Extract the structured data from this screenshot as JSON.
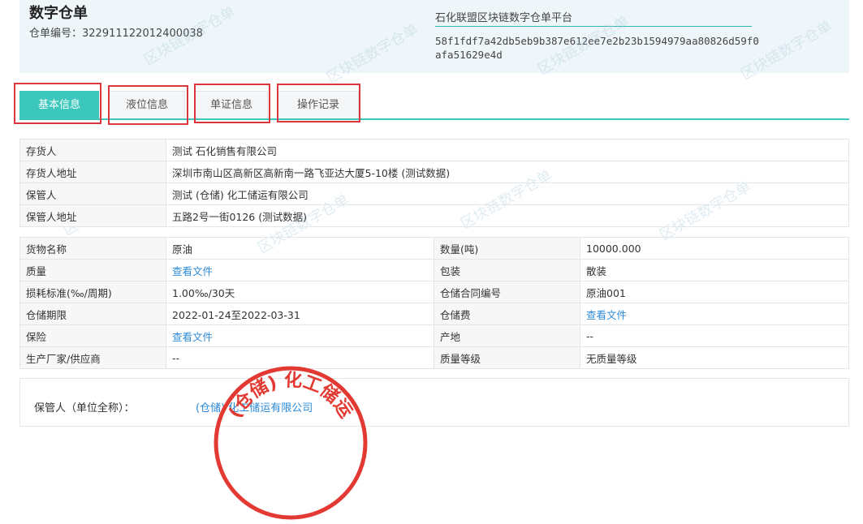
{
  "header": {
    "title": "数字仓单",
    "receipt_no": "仓单编号：322911122012400038",
    "platform": "石化联盟区块链数字仓单平台",
    "hash": "58f1fdf7a42db5eb9b387e612ee7e2b23b1594979aa80826d59f0afa51629e4d"
  },
  "watermark_text": "区块链数字仓单",
  "tabs": [
    {
      "label": "基本信息",
      "active": true
    },
    {
      "label": "液位信息",
      "active": false
    },
    {
      "label": "单证信息",
      "active": false
    },
    {
      "label": "操作记录",
      "active": false
    }
  ],
  "party": {
    "depositor_label": "存货人",
    "depositor_value": "测试 石化销售有限公司",
    "depositor_addr_label": "存货人地址",
    "depositor_addr_value": "深圳市南山区高新区高新南一路飞亚达大厦5-10楼 (测试数据)",
    "keeper_label": "保管人",
    "keeper_value": "测试 (仓储) 化工储运有限公司",
    "keeper_addr_label": "保管人地址",
    "keeper_addr_value": "五路2号一街0126 (测试数据)"
  },
  "goods": {
    "name_label": "货物名称",
    "name_value": "原油",
    "qty_label": "数量(吨)",
    "qty_value": "10000.000",
    "quality_label": "质量",
    "quality_value": "查看文件",
    "pack_label": "包装",
    "pack_value": "散装",
    "loss_label": "损耗标准(‰/周期)",
    "loss_value": "1.00‰/30天",
    "contract_label": "仓储合同编号",
    "contract_value": "原油001",
    "period_label": "仓储期限",
    "period_value": "2022-01-24至2022-03-31",
    "fee_label": "仓储费",
    "fee_value": "查看文件",
    "insure_label": "保险",
    "insure_value": "查看文件",
    "origin_label": "产地",
    "origin_value": "--",
    "maker_label": "生产厂家/供应商",
    "maker_value": "--",
    "grade_label": "质量等级",
    "grade_value": "无质量等级"
  },
  "signature": {
    "keeper_full_label": "保管人（单位全称）：",
    "keeper_full_value": "(仓储) 化工储运有限公司",
    "seal_text": "(仓储) 化工储运"
  },
  "colors": {
    "accent": "#3cc7bd",
    "link": "#2b8ad8",
    "highlight_box": "#d9363e",
    "seal": "#e23a32"
  }
}
